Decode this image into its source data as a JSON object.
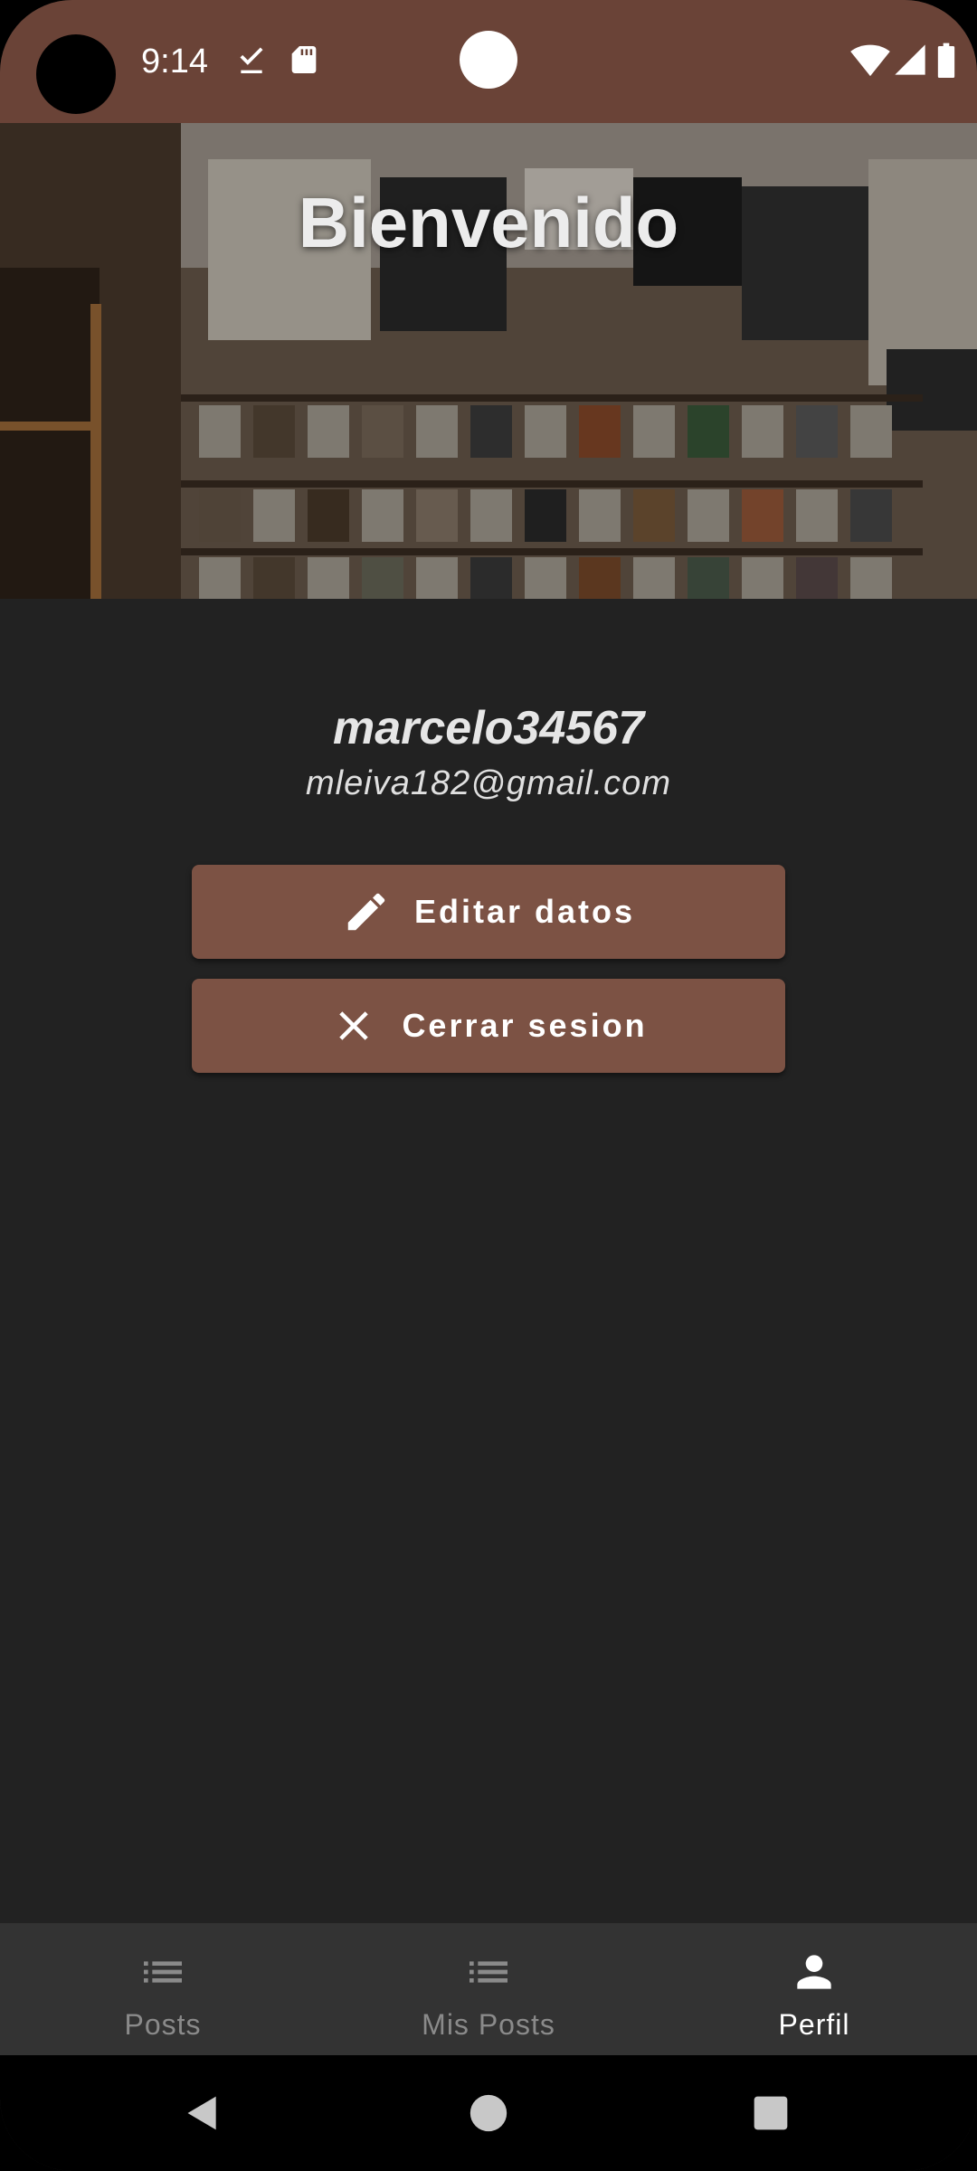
{
  "status_bar": {
    "time": "9:14",
    "left_icons": [
      "check-download-icon",
      "sd-card-icon"
    ],
    "right_icons": [
      "wifi-icon",
      "signal-icon",
      "battery-icon"
    ]
  },
  "header": {
    "title": "Bienvenido",
    "background": "record-store-photo"
  },
  "profile": {
    "username": "marcelo34567",
    "email": "mleiva182@gmail.com"
  },
  "actions": {
    "edit_label": "Editar datos",
    "edit_icon": "pencil-icon",
    "logout_label": "Cerrar sesion",
    "logout_icon": "close-icon"
  },
  "bottom_nav": {
    "items": [
      {
        "label": "Posts",
        "icon": "list-icon",
        "active": false
      },
      {
        "label": "Mis Posts",
        "icon": "list-icon",
        "active": false
      },
      {
        "label": "Perfil",
        "icon": "person-icon",
        "active": true
      }
    ]
  },
  "system_nav": {
    "buttons": [
      "back-icon",
      "home-icon",
      "recents-icon"
    ]
  },
  "colors": {
    "primary": "#6a4337",
    "button": "#7c5244",
    "background": "#222222",
    "nav_background": "#333333"
  }
}
